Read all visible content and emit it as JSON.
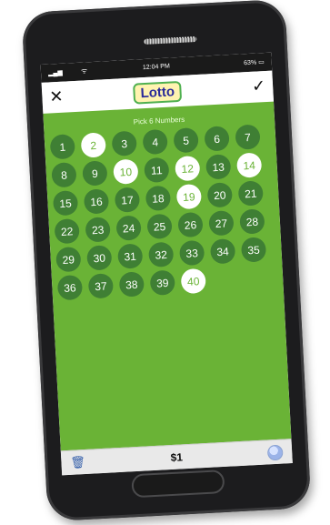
{
  "status_bar": {
    "time": "12:04 PM",
    "battery": "63%"
  },
  "header": {
    "logo_text": "Lotto",
    "close_label": "✕",
    "confirm_label": "✓"
  },
  "pick": {
    "label": "Pick 6 Numbers",
    "numbers": [
      1,
      2,
      3,
      4,
      5,
      6,
      7,
      8,
      9,
      10,
      11,
      12,
      13,
      14,
      15,
      16,
      17,
      18,
      19,
      20,
      21,
      22,
      23,
      24,
      25,
      26,
      27,
      28,
      29,
      30,
      31,
      32,
      33,
      34,
      35,
      36,
      37,
      38,
      39,
      40
    ],
    "selected": [
      2,
      10,
      12,
      14,
      19,
      40
    ]
  },
  "footer": {
    "price": "$1"
  },
  "icons": [
    "close-icon",
    "check-icon",
    "trash-icon",
    "quick-pick-icon",
    "wifi-icon",
    "signal-icon",
    "battery-icon"
  ]
}
